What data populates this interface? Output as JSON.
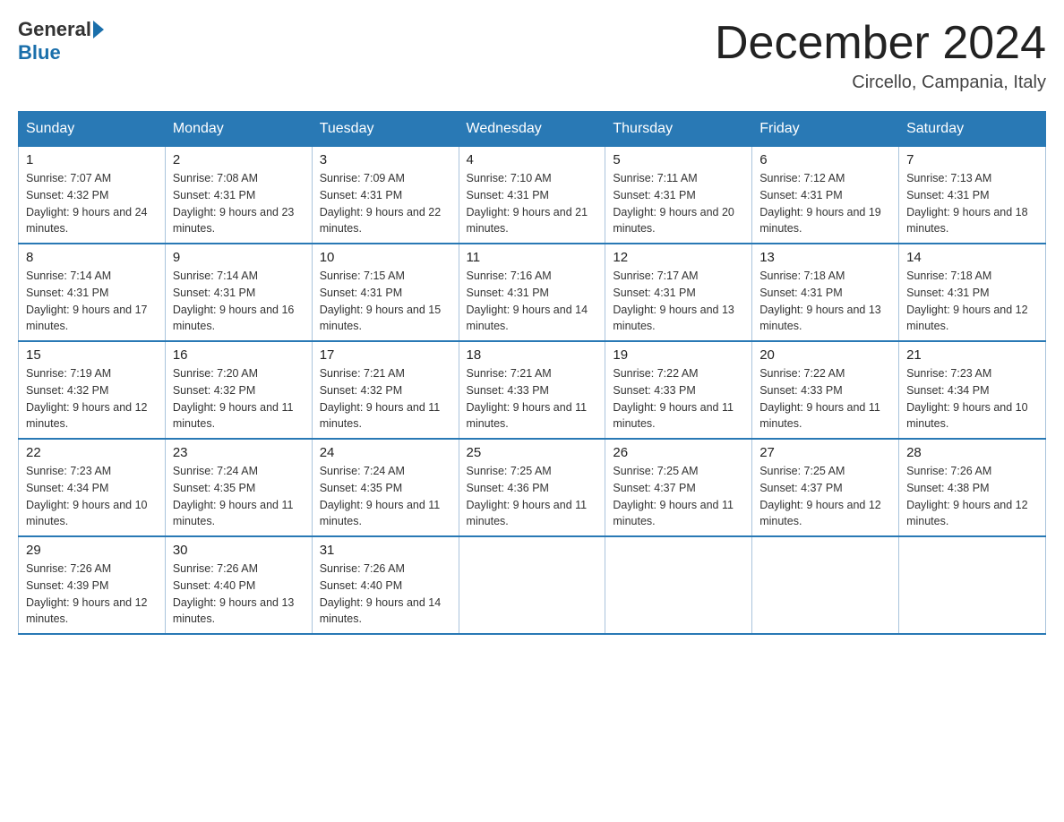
{
  "logo": {
    "general": "General",
    "blue": "Blue"
  },
  "title": "December 2024",
  "location": "Circello, Campania, Italy",
  "days_of_week": [
    "Sunday",
    "Monday",
    "Tuesday",
    "Wednesday",
    "Thursday",
    "Friday",
    "Saturday"
  ],
  "weeks": [
    [
      {
        "day": "1",
        "sunrise": "7:07 AM",
        "sunset": "4:32 PM",
        "daylight": "9 hours and 24 minutes."
      },
      {
        "day": "2",
        "sunrise": "7:08 AM",
        "sunset": "4:31 PM",
        "daylight": "9 hours and 23 minutes."
      },
      {
        "day": "3",
        "sunrise": "7:09 AM",
        "sunset": "4:31 PM",
        "daylight": "9 hours and 22 minutes."
      },
      {
        "day": "4",
        "sunrise": "7:10 AM",
        "sunset": "4:31 PM",
        "daylight": "9 hours and 21 minutes."
      },
      {
        "day": "5",
        "sunrise": "7:11 AM",
        "sunset": "4:31 PM",
        "daylight": "9 hours and 20 minutes."
      },
      {
        "day": "6",
        "sunrise": "7:12 AM",
        "sunset": "4:31 PM",
        "daylight": "9 hours and 19 minutes."
      },
      {
        "day": "7",
        "sunrise": "7:13 AM",
        "sunset": "4:31 PM",
        "daylight": "9 hours and 18 minutes."
      }
    ],
    [
      {
        "day": "8",
        "sunrise": "7:14 AM",
        "sunset": "4:31 PM",
        "daylight": "9 hours and 17 minutes."
      },
      {
        "day": "9",
        "sunrise": "7:14 AM",
        "sunset": "4:31 PM",
        "daylight": "9 hours and 16 minutes."
      },
      {
        "day": "10",
        "sunrise": "7:15 AM",
        "sunset": "4:31 PM",
        "daylight": "9 hours and 15 minutes."
      },
      {
        "day": "11",
        "sunrise": "7:16 AM",
        "sunset": "4:31 PM",
        "daylight": "9 hours and 14 minutes."
      },
      {
        "day": "12",
        "sunrise": "7:17 AM",
        "sunset": "4:31 PM",
        "daylight": "9 hours and 13 minutes."
      },
      {
        "day": "13",
        "sunrise": "7:18 AM",
        "sunset": "4:31 PM",
        "daylight": "9 hours and 13 minutes."
      },
      {
        "day": "14",
        "sunrise": "7:18 AM",
        "sunset": "4:31 PM",
        "daylight": "9 hours and 12 minutes."
      }
    ],
    [
      {
        "day": "15",
        "sunrise": "7:19 AM",
        "sunset": "4:32 PM",
        "daylight": "9 hours and 12 minutes."
      },
      {
        "day": "16",
        "sunrise": "7:20 AM",
        "sunset": "4:32 PM",
        "daylight": "9 hours and 11 minutes."
      },
      {
        "day": "17",
        "sunrise": "7:21 AM",
        "sunset": "4:32 PM",
        "daylight": "9 hours and 11 minutes."
      },
      {
        "day": "18",
        "sunrise": "7:21 AM",
        "sunset": "4:33 PM",
        "daylight": "9 hours and 11 minutes."
      },
      {
        "day": "19",
        "sunrise": "7:22 AM",
        "sunset": "4:33 PM",
        "daylight": "9 hours and 11 minutes."
      },
      {
        "day": "20",
        "sunrise": "7:22 AM",
        "sunset": "4:33 PM",
        "daylight": "9 hours and 11 minutes."
      },
      {
        "day": "21",
        "sunrise": "7:23 AM",
        "sunset": "4:34 PM",
        "daylight": "9 hours and 10 minutes."
      }
    ],
    [
      {
        "day": "22",
        "sunrise": "7:23 AM",
        "sunset": "4:34 PM",
        "daylight": "9 hours and 10 minutes."
      },
      {
        "day": "23",
        "sunrise": "7:24 AM",
        "sunset": "4:35 PM",
        "daylight": "9 hours and 11 minutes."
      },
      {
        "day": "24",
        "sunrise": "7:24 AM",
        "sunset": "4:35 PM",
        "daylight": "9 hours and 11 minutes."
      },
      {
        "day": "25",
        "sunrise": "7:25 AM",
        "sunset": "4:36 PM",
        "daylight": "9 hours and 11 minutes."
      },
      {
        "day": "26",
        "sunrise": "7:25 AM",
        "sunset": "4:37 PM",
        "daylight": "9 hours and 11 minutes."
      },
      {
        "day": "27",
        "sunrise": "7:25 AM",
        "sunset": "4:37 PM",
        "daylight": "9 hours and 12 minutes."
      },
      {
        "day": "28",
        "sunrise": "7:26 AM",
        "sunset": "4:38 PM",
        "daylight": "9 hours and 12 minutes."
      }
    ],
    [
      {
        "day": "29",
        "sunrise": "7:26 AM",
        "sunset": "4:39 PM",
        "daylight": "9 hours and 12 minutes."
      },
      {
        "day": "30",
        "sunrise": "7:26 AM",
        "sunset": "4:40 PM",
        "daylight": "9 hours and 13 minutes."
      },
      {
        "day": "31",
        "sunrise": "7:26 AM",
        "sunset": "4:40 PM",
        "daylight": "9 hours and 14 minutes."
      },
      null,
      null,
      null,
      null
    ]
  ]
}
